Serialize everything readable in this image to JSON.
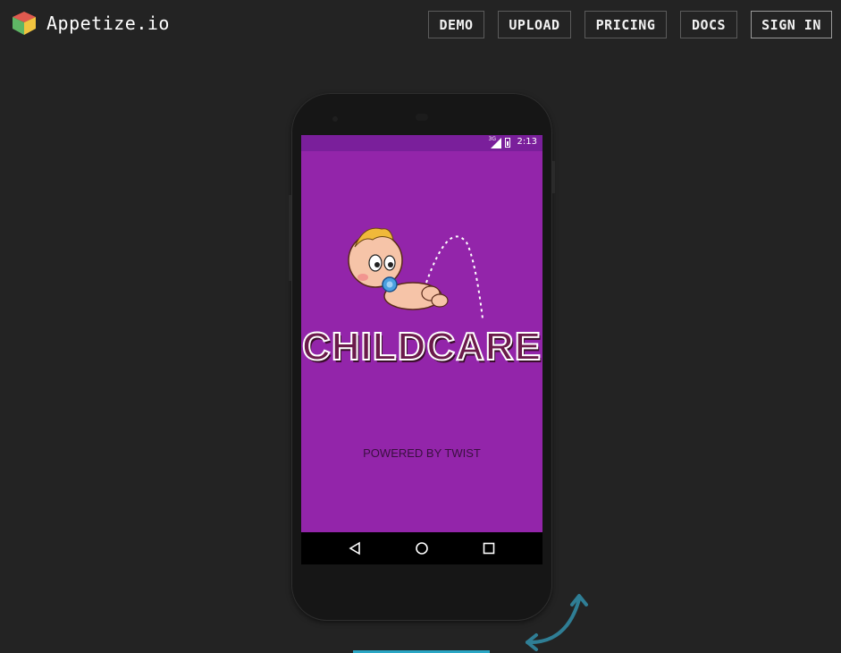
{
  "header": {
    "brand": "Appetize.io",
    "nav": [
      {
        "label": "DEMO"
      },
      {
        "label": "UPLOAD"
      },
      {
        "label": "PRICING"
      },
      {
        "label": "DOCS"
      },
      {
        "label": "SIGN IN"
      }
    ]
  },
  "device": {
    "status_bar": {
      "time": "2:13",
      "network": "3G"
    },
    "app": {
      "logo_text": "CHILDCARE",
      "powered_by": "POWERED BY TWIST"
    },
    "nav_buttons": [
      "back-icon",
      "home-icon",
      "recent-apps-icon"
    ]
  },
  "colors": {
    "background": "#232323",
    "app_background": "#9325aa",
    "status_bar": "#7a1f9b",
    "accent": "#2aa6c4"
  }
}
